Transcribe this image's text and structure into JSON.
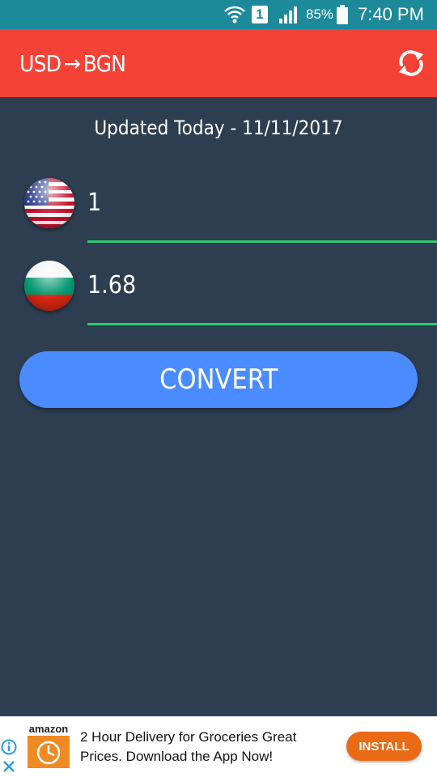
{
  "status_bar": {
    "sim_label": "1",
    "battery_percent": "85%",
    "time": "7:40 PM",
    "icons": [
      "wifi-icon",
      "sim-icon",
      "signal-icon",
      "battery-icon"
    ]
  },
  "app_bar": {
    "from_currency": "USD",
    "arrow": "→",
    "to_currency": "BGN",
    "refresh_icon": "refresh-icon"
  },
  "updated_text": "Updated Today - 11/11/2017",
  "converter": {
    "from": {
      "flag": "us-flag-icon",
      "value": "1"
    },
    "to": {
      "flag": "bg-flag-icon",
      "value": "1.68"
    },
    "convert_label": "CONVERT"
  },
  "ad": {
    "brand": "amazon",
    "text": "2 Hour Delivery for Groceries Great Prices. Download the App Now!",
    "install_label": "INSTALL",
    "icons": [
      "info-icon",
      "close-icon",
      "clock-icon"
    ]
  },
  "colors": {
    "status_bar": "#1c8a9a",
    "app_bar": "#f44336",
    "background": "#2d3e50",
    "field_underline": "#2ecc71",
    "convert_button": "#4a8cff",
    "install_button": "#ea6a16"
  }
}
